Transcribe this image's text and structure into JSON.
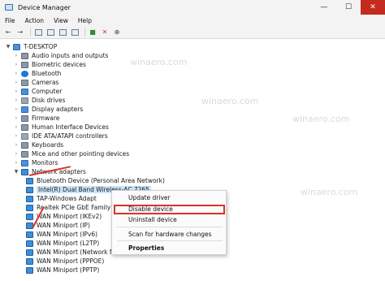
{
  "window": {
    "title": "Device Manager"
  },
  "window_controls": {
    "minimize": "—",
    "maximize": "☐",
    "close": "✕"
  },
  "menu": [
    "File",
    "Action",
    "View",
    "Help"
  ],
  "toolbar": {
    "back": "←",
    "forward": "→"
  },
  "tree": {
    "root": "T-DESKTOP",
    "categories": [
      "Audio inputs and outputs",
      "Biometric devices",
      "Bluetooth",
      "Cameras",
      "Computer",
      "Disk drives",
      "Display adapters",
      "Firmware",
      "Human Interface Devices",
      "IDE ATA/ATAPI controllers",
      "Keyboards",
      "Mice and other pointing devices",
      "Monitors",
      "Network adapters"
    ],
    "network_children": [
      "Bluetooth Device (Personal Area Network)",
      "Intel(R) Dual Band Wireless-AC 7265",
      "TAP-Windows Adapt",
      "Realtek PCIe GbE Family Co",
      "WAN Miniport (IKEv2)",
      "WAN Miniport (IP)",
      "WAN Miniport (IPv6)",
      "WAN Miniport (L2TP)",
      "WAN Miniport (Network M",
      "WAN Miniport (PPPOE)",
      "WAN Miniport (PPTP)"
    ]
  },
  "context_menu": {
    "update": "Update driver",
    "disable": "Disable device",
    "uninstall": "Uninstall device",
    "scan": "Scan for hardware changes",
    "properties": "Properties"
  },
  "watermark": "winaero.com",
  "colors": {
    "highlight": "#d9342b",
    "selection": "#cce4f7"
  }
}
